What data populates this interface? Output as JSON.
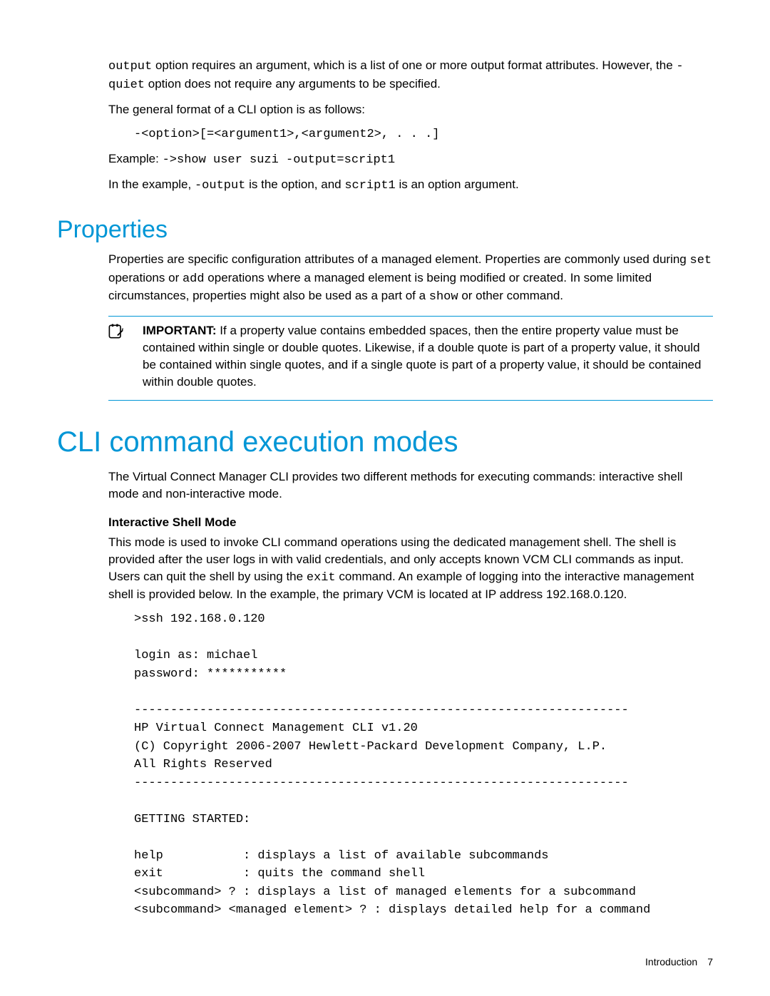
{
  "intro": {
    "p1_pre": "",
    "p1_code1": "output",
    "p1_mid1": " option requires an argument, which is a list of one or more output format attributes. However, the ",
    "p1_code2": "-quiet",
    "p1_mid2": " option does not require any arguments to be specified.",
    "p2": "The general format of a CLI option is as follows:",
    "p2_code": "-<option>[=<argument1>,<argument2>, . . .]",
    "p3_prefix": "Example: ",
    "p3_code": "->show user suzi -output=script1",
    "p4_a": "In the example, ",
    "p4_code1": "-output",
    "p4_b": " is the option, and ",
    "p4_code2": "script1",
    "p4_c": " is an option argument."
  },
  "properties": {
    "heading": "Properties",
    "p1_a": "Properties are specific configuration attributes of a managed element. Properties are commonly used during ",
    "p1_code1": "set",
    "p1_b": " operations or ",
    "p1_code2": "add",
    "p1_c": " operations where a managed element is being modified or created. In some limited circumstances, properties might also be used as a part of a ",
    "p1_code3": "show",
    "p1_d": " or other command.",
    "note_label": "IMPORTANT:",
    "note_text": "  If a property value contains embedded spaces, then the entire property value must be contained within single or double quotes. Likewise, if a double quote is part of a property value, it should be contained within single quotes, and if a single quote is part of a property value, it should be contained within double quotes."
  },
  "cli_modes": {
    "heading": "CLI command execution modes",
    "p1": "The Virtual Connect Manager CLI provides two different methods for executing commands: interactive shell mode and non-interactive mode.",
    "subhead": "Interactive Shell Mode",
    "p2_a": "This mode is used to invoke CLI command operations using the dedicated management shell. The shell is provided after the user logs in with valid credentials, and only accepts known VCM CLI commands as input. Users can quit the shell by using the ",
    "p2_code": "exit",
    "p2_b": " command. An example of logging into the interactive management shell is provided below. In the example, the primary VCM is located at IP address 192.168.0.120.",
    "codeblock": ">ssh 192.168.0.120\n\nlogin as: michael\npassword: ***********\n\n--------------------------------------------------------------------\nHP Virtual Connect Management CLI v1.20\n(C) Copyright 2006-2007 Hewlett-Packard Development Company, L.P.\nAll Rights Reserved\n--------------------------------------------------------------------\n\nGETTING STARTED:\n\nhelp           : displays a list of available subcommands\nexit           : quits the command shell\n<subcommand> ? : displays a list of managed elements for a subcommand\n<subcommand> <managed element> ? : displays detailed help for a command"
  },
  "footer": {
    "section": "Introduction",
    "page": "7"
  }
}
